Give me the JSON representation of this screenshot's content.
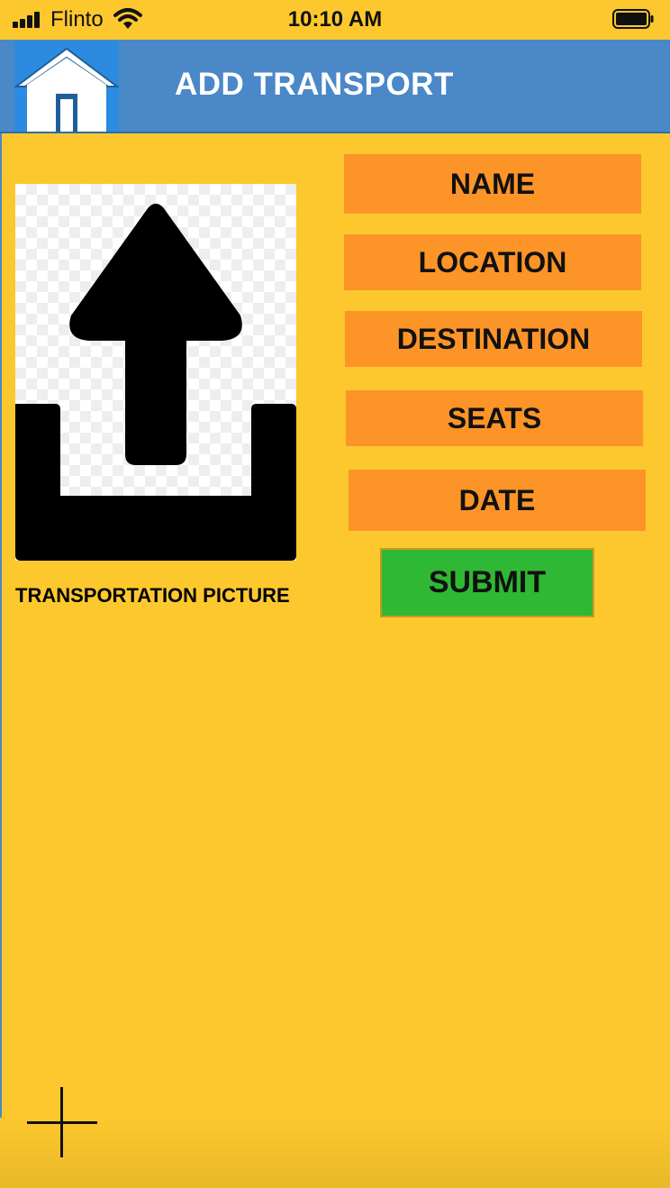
{
  "status_bar": {
    "carrier": "Flinto",
    "time": "10:10 AM"
  },
  "nav": {
    "title": "ADD TRANSPORT",
    "home_icon": "home-icon"
  },
  "upload": {
    "icon": "upload-icon",
    "label": "TRANSPORTATION PICTURE"
  },
  "fields": {
    "name": "NAME",
    "location": "LOCATION",
    "destination": "DESTINATION",
    "seats": "SEATS",
    "date": "DATE"
  },
  "submit_label": "SUBMIT",
  "add_icon": "plus-icon",
  "colors": {
    "background": "#fcc82e",
    "nav": "#4a88c8",
    "field": "#fd9428",
    "submit": "#2fb833",
    "title_text": "#ffffff"
  }
}
